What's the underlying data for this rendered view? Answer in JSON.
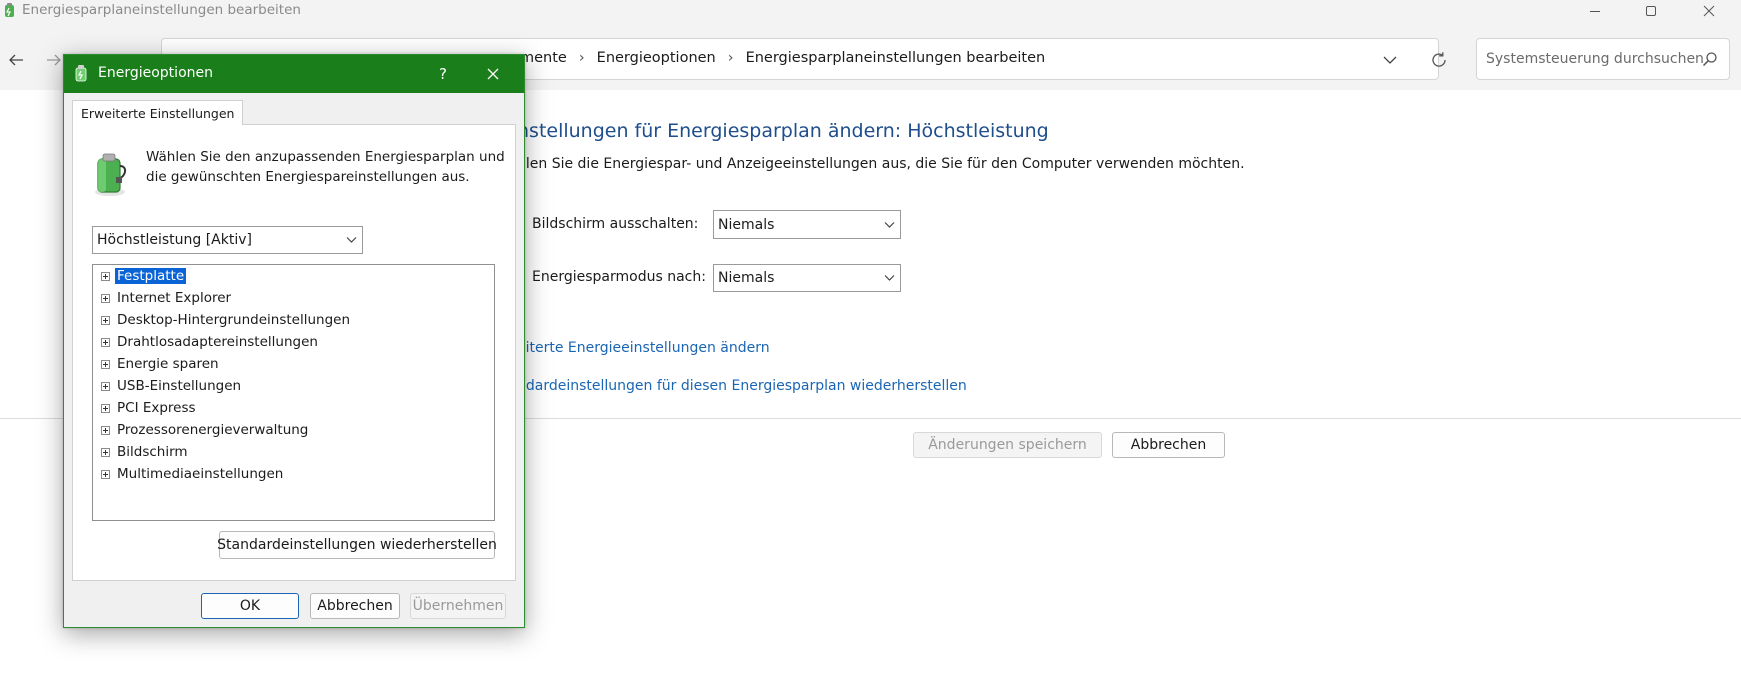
{
  "window": {
    "title": "Energiesparplaneinstellungen bearbeiten"
  },
  "address": {
    "crumb_partial": "mente",
    "crumb_2": "Energieoptionen",
    "crumb_3": "Energiesparplaneinstellungen bearbeiten"
  },
  "search": {
    "placeholder": "Systemsteuerung durchsuchen"
  },
  "main": {
    "heading": "nstellungen für Energiesparplan ändern: Höchstleistung",
    "description": "hlen Sie die Energiespar- und Anzeigeeinstellungen aus, die Sie für den Computer verwenden möchten.",
    "settings": [
      {
        "label": "Bildschirm ausschalten:",
        "value": "Niemals"
      },
      {
        "label": "Energiesparmodus nach:",
        "value": "Niemals"
      }
    ],
    "links": [
      "eiterte Energieeinstellungen ändern",
      "ndardeinstellungen für diesen Energiesparplan wiederherstellen"
    ],
    "save_label": "Änderungen speichern",
    "cancel_label": "Abbrechen"
  },
  "dialog": {
    "title": "Energieoptionen",
    "help": "?",
    "tab": "Erweiterte Einstellungen",
    "intro": "Wählen Sie den anzupassenden Energiesparplan und die gewünschten Energiespareinstellungen aus.",
    "plan": "Höchstleistung [Aktiv]",
    "tree": [
      "Festplatte",
      "Internet Explorer",
      "Desktop-Hintergrundeinstellungen",
      "Drahtlosadaptereinstellungen",
      "Energie sparen",
      "USB-Einstellungen",
      "PCI Express",
      "Prozessorenergieverwaltung",
      "Bildschirm",
      "Multimediaeinstellungen"
    ],
    "selected_item": "Festplatte",
    "restore_label": "Standardeinstellungen wiederherstellen",
    "ok_label": "OK",
    "cancel_label": "Abbrechen",
    "apply_label": "Übernehmen"
  },
  "colors": {
    "dialog_titlebar": "#1a7f1a",
    "link": "#1a66b4",
    "heading": "#1e4e8c",
    "selection": "#0a64d6"
  }
}
